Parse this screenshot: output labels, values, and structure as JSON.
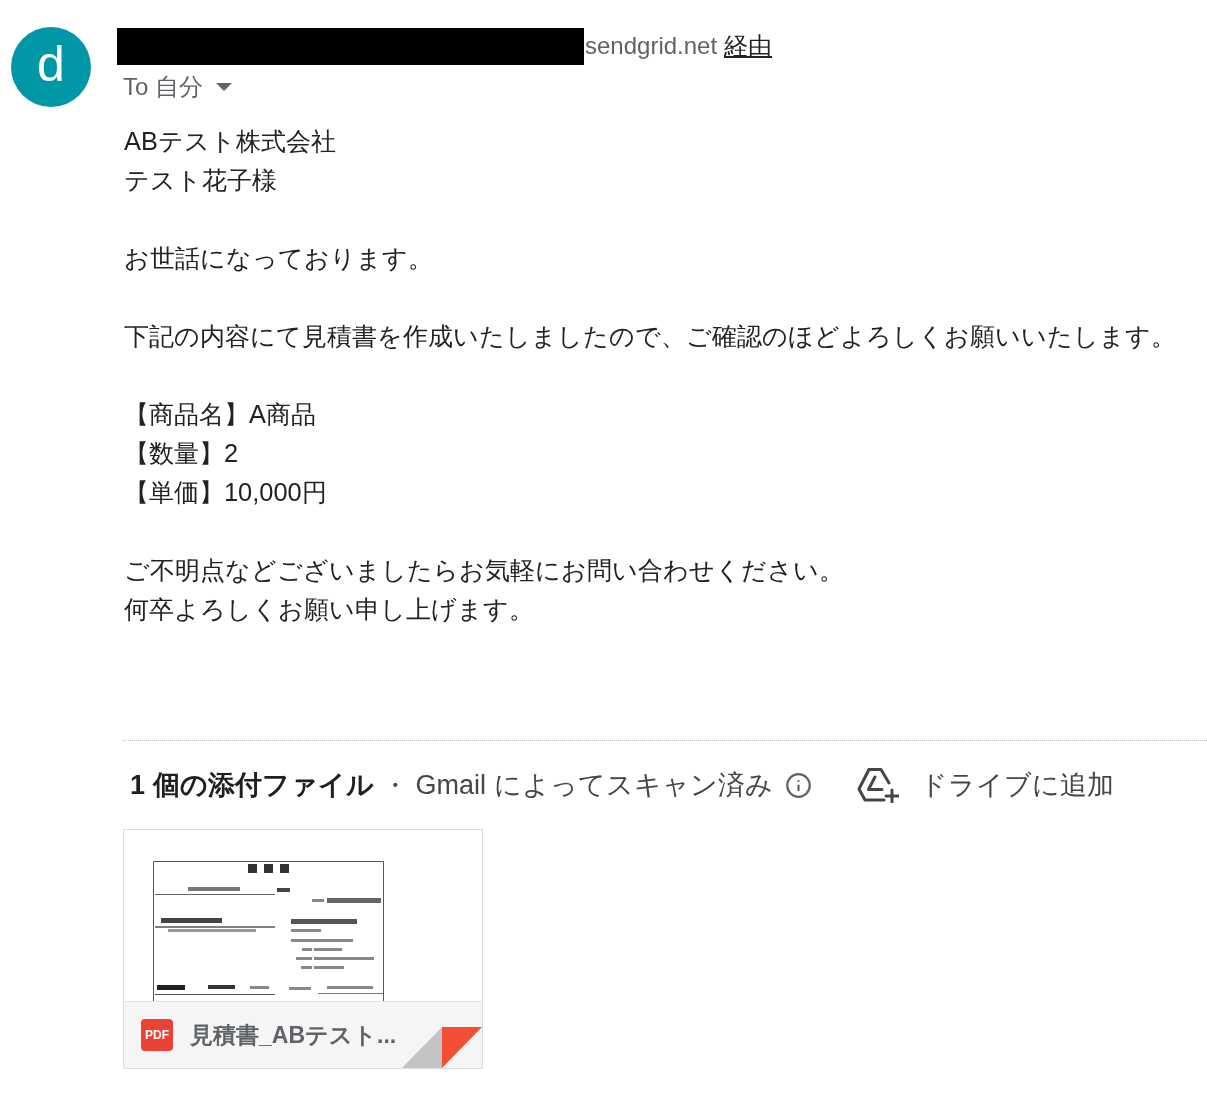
{
  "message": {
    "avatar_letter": "d",
    "sender": {
      "domain": "sendgrid.net",
      "via": "経由"
    },
    "recipient": "To 自分",
    "body": [
      [
        "ABテスト株式会社",
        "テスト花子様"
      ],
      [
        "お世話になっております。"
      ],
      [
        "下記の内容にて見積書を作成いたしましたので、ご確認のほどよろしくお願いいたします。"
      ],
      [
        "【商品名】A商品",
        "【数量】2",
        "【単価】10,000円"
      ],
      [
        "ご不明点などございましたらお気軽にお問い合わせください。",
        "何卒よろしくお願い申し上げます。"
      ]
    ]
  },
  "attachments": {
    "count_label": "1 個の添付ファイル",
    "separator": "・",
    "scan_note": "Gmail によってスキャン済み",
    "drive_button": "ドライブに追加",
    "files": [
      {
        "type_label": "PDF",
        "name": "見積書_ABテスト..."
      }
    ]
  }
}
